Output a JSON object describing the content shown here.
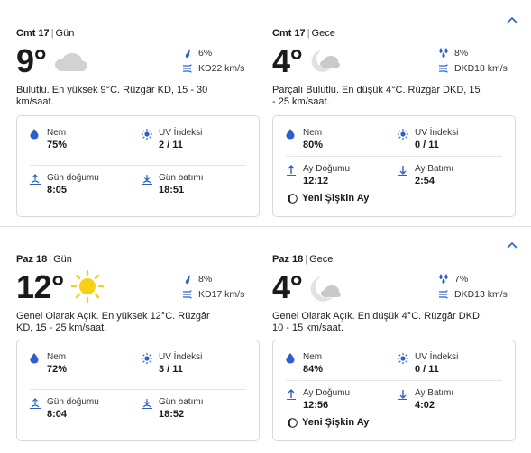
{
  "days": [
    {
      "day": {
        "header": "Cmt 17",
        "period": "Gün",
        "temp": "9°",
        "icon": "cloudy-icon",
        "precip": "6%",
        "wind": "KD22 km/s",
        "desc_line1": "Bulutlu. En yüksek 9°C. Rüzgâr KD, 15 - 30",
        "desc_line2": "km/saat.",
        "humidity_label": "Nem",
        "humidity": "75%",
        "uv_label": "UV İndeksi",
        "uv": "2 / 11",
        "rise_label": "Gün doğumu",
        "rise": "8:05",
        "set_label": "Gün batımı",
        "set": "18:51"
      },
      "night": {
        "header": "Cmt 17",
        "period": "Gece",
        "temp": "4°",
        "icon": "partly-cloudy-night-icon",
        "precip": "8%",
        "wind": "DKD18 km/s",
        "desc_line1": "Parçalı Bulutlu. En düşük 4°C. Rüzgâr DKD, 15",
        "desc_line2": "- 25 km/saat.",
        "humidity_label": "Nem",
        "humidity": "80%",
        "uv_label": "UV İndeksi",
        "uv": "0 / 11",
        "rise_label": "Ay Doğumu",
        "rise": "12:12",
        "set_label": "Ay Batımı",
        "set": "2:54",
        "moon_phase": "Yeni Şişkin Ay"
      }
    },
    {
      "day": {
        "header": "Paz 18",
        "period": "Gün",
        "temp": "12°",
        "icon": "sunny-icon",
        "precip": "8%",
        "wind": "KD17 km/s",
        "desc_line1": "Genel Olarak Açık. En yüksek 12°C. Rüzgâr",
        "desc_line2": "KD, 15 - 25 km/saat.",
        "humidity_label": "Nem",
        "humidity": "72%",
        "uv_label": "UV İndeksi",
        "uv": "3 / 11",
        "rise_label": "Gün doğumu",
        "rise": "8:04",
        "set_label": "Gün batımı",
        "set": "18:52"
      },
      "night": {
        "header": "Paz 18",
        "period": "Gece",
        "temp": "4°",
        "icon": "partly-cloudy-night-icon",
        "precip": "7%",
        "wind": "DKD13 km/s",
        "desc_line1": "Genel Olarak Açık. En düşük 4°C. Rüzgâr DKD,",
        "desc_line2": "10 - 15 km/saat.",
        "humidity_label": "Nem",
        "humidity": "84%",
        "uv_label": "UV İndeksi",
        "uv": "0 / 11",
        "rise_label": "Ay Doğumu",
        "rise": "12:56",
        "set_label": "Ay Batımı",
        "set": "4:02",
        "moon_phase": "Yeni Şişkin Ay"
      }
    }
  ],
  "colors": {
    "accent": "#2b5fc9",
    "text": "#1a1a1a",
    "border": "#d8d8d8",
    "sun": "#f7cf16",
    "cloud": "#d2d2d2"
  }
}
